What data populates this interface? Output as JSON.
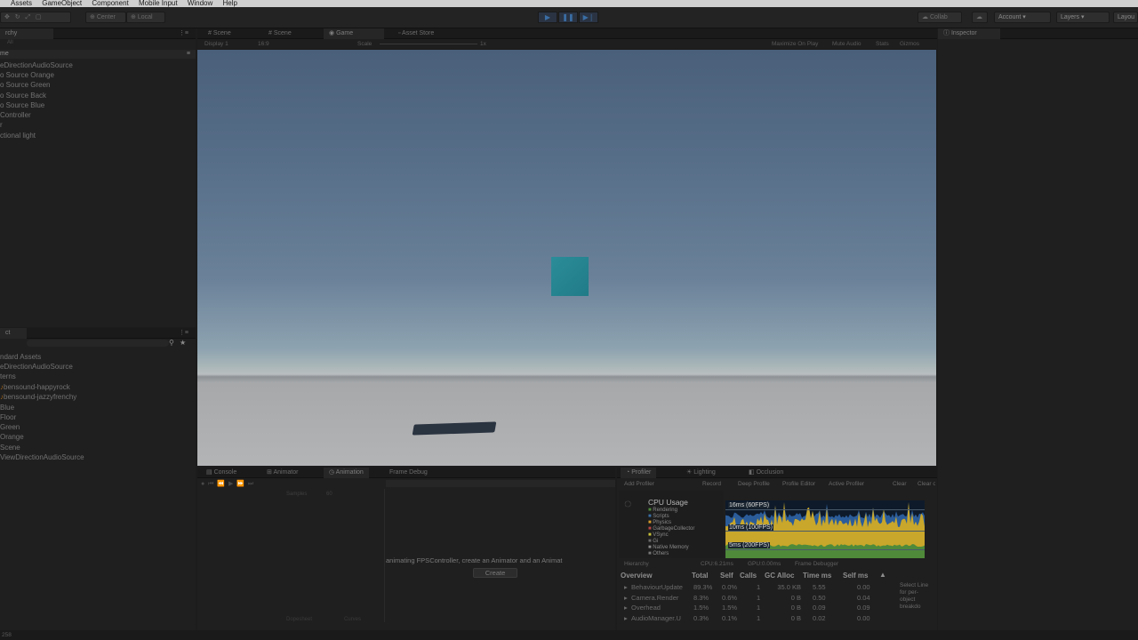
{
  "menubar": [
    "Assets",
    "GameObject",
    "Component",
    "Mobile Input",
    "Window",
    "Help"
  ],
  "toolbar": {
    "pivot": "Center",
    "space": "Local",
    "collab": "Collab",
    "account": "Account",
    "layers": "Layers",
    "layout": "Layou"
  },
  "hierarchy": {
    "tab": "rchy",
    "search": "All",
    "scene": "me",
    "items": [
      "eDirectionAudioSource",
      "o Source Orange",
      "o Source Green",
      "o Source Back",
      "o Source Blue",
      "Controller",
      "r",
      "ctional light"
    ]
  },
  "project": {
    "tab": "ct",
    "items": [
      "ndard Assets",
      "eDirectionAudioSource",
      "terns",
      "bensound-happyrock",
      "bensound-jazzyfrenchy",
      "Blue",
      "Floor",
      "Green",
      "Orange",
      "Scene",
      "ViewDirectionAudioSource"
    ]
  },
  "center_tabs": [
    "Scene",
    "Scene",
    "Game",
    "Asset Store"
  ],
  "game_bar": {
    "display": "Display 1",
    "aspect": "16:9",
    "scale": "Scale",
    "scale_val": "1x",
    "options": [
      "Maximize On Play",
      "Mute Audio",
      "Stats",
      "Gizmos"
    ]
  },
  "inspector_tab": "Inspector",
  "bottom_tabs": [
    "Console",
    "Animator",
    "Animation",
    "Frame Debug"
  ],
  "animation": {
    "samples_label": "Samples",
    "samples_value": "60",
    "message": "animating FPSController, create an Animator and an Animat",
    "create_button": "Create",
    "footer": [
      "Dopesheet",
      "Curves"
    ]
  },
  "profiler_tabs": [
    "Profiler",
    "Lighting",
    "Occlusion"
  ],
  "profiler": {
    "toolbar": [
      "Add Profiler",
      "Record",
      "Deep Profile",
      "Profile Editor",
      "Active Profiler",
      "Clear",
      "Clear on Play"
    ],
    "cpu_title": "CPU Usage",
    "legend": [
      "Rendering",
      "Scripts",
      "Physics",
      "GarbageCollector",
      "VSync",
      "Gi",
      "Native Memory",
      "Others"
    ],
    "legend_colors": [
      "#4f8a3a",
      "#3a6fa5",
      "#d49b2a",
      "#b84545",
      "#c9c23a",
      "#6a6a6a",
      "#8a8a8a",
      "#777777"
    ],
    "graph_labels": [
      "16ms (60FPS)",
      "10ms (100FPS)",
      "5ms (200FPS)"
    ],
    "info_mode": "Hierarchy",
    "cpu_time": "CPU:6.21ms",
    "gpu_time": "GPU:0.00ms",
    "frame_debugger": "Frame Debugger",
    "columns": [
      "Overview",
      "Total",
      "Self",
      "Calls",
      "GC Alloc",
      "Time ms",
      "Self ms"
    ],
    "rows": [
      [
        "BehaviourUpdate",
        "89.3%",
        "0.0%",
        "1",
        "35.0 KB",
        "5.55",
        "0.00"
      ],
      [
        "Camera.Render",
        "8.3%",
        "0.6%",
        "1",
        "0 B",
        "0.50",
        "0.04"
      ],
      [
        "Overhead",
        "1.5%",
        "1.5%",
        "1",
        "0 B",
        "0.09",
        "0.09"
      ],
      [
        "AudioManager.U",
        "0.3%",
        "0.1%",
        "1",
        "0 B",
        "0.02",
        "0.00"
      ]
    ],
    "side_note": "Select Line for per-object breakdo"
  },
  "statusbar": "258"
}
